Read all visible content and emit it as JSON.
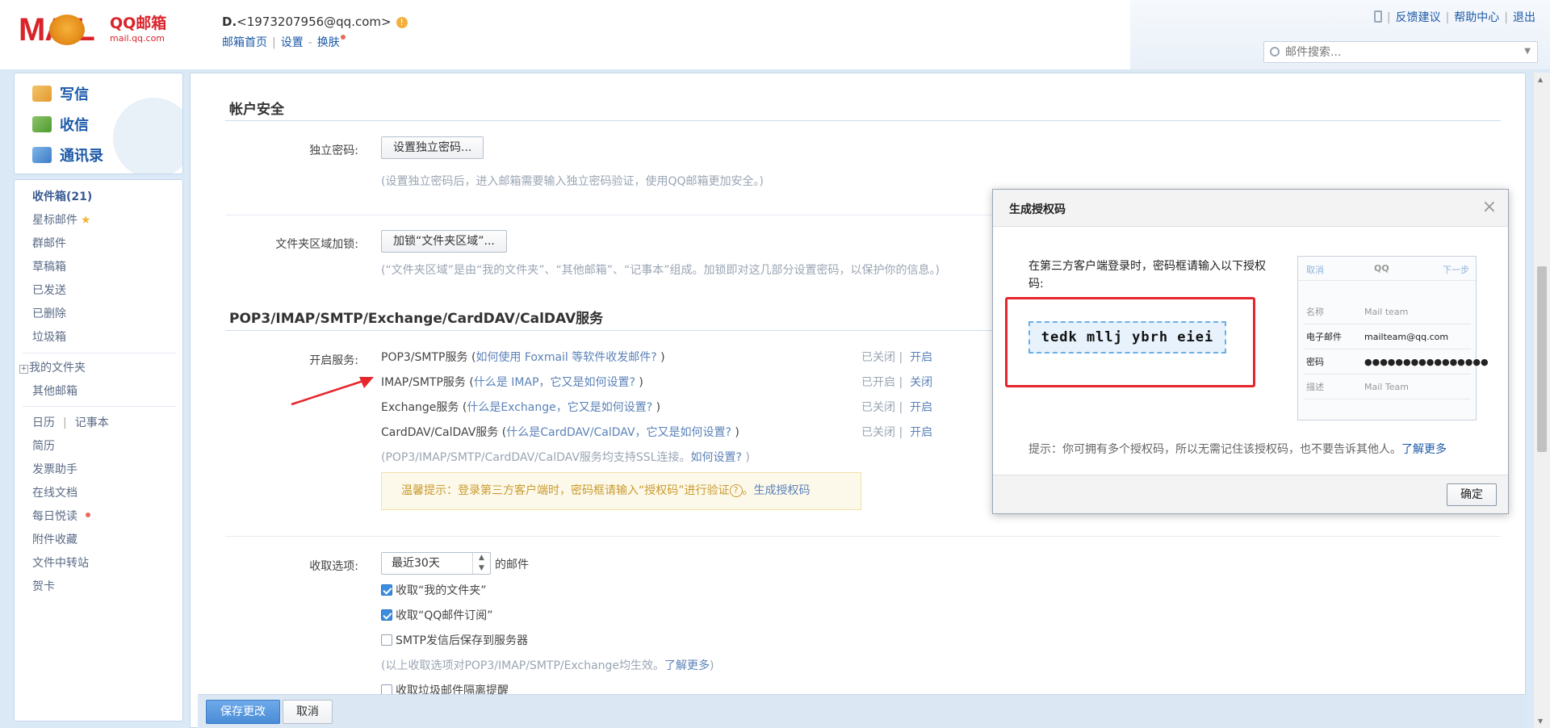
{
  "header": {
    "logo_text": "MAIL",
    "brand": "QQ邮箱",
    "brand_url": "mail.qq.com",
    "user_name": "D.",
    "user_email": "<1973207956@qq.com>",
    "links": [
      "邮箱首页",
      "设置",
      "换肤"
    ],
    "top_links": [
      "反馈建议",
      "帮助中心",
      "退出"
    ],
    "search_placeholder": "邮件搜索..."
  },
  "sidebar": {
    "actions": [
      "写信",
      "收信",
      "通讯录"
    ],
    "inbox": "收件箱(21)",
    "folders": [
      "星标邮件",
      "群邮件",
      "草稿箱",
      "已发送",
      "已删除",
      "垃圾箱"
    ],
    "my_folders": "我的文件夹",
    "other_mail": "其他邮箱",
    "calendar": "日历",
    "notebook": "记事本",
    "apps": [
      "简历",
      "发票助手",
      "在线文档",
      "每日悦读",
      "附件收藏",
      "文件中转站",
      "贺卡"
    ]
  },
  "account_security": {
    "title": "帐户安全",
    "independent_password": {
      "label": "独立密码:",
      "button": "设置独立密码...",
      "hint": "(设置独立密码后，进入邮箱需要输入独立密码验证，使用QQ邮箱更加安全。)"
    },
    "folder_lock": {
      "label": "文件夹区域加锁:",
      "button": "加锁“文件夹区域”...",
      "hint": "(“文件夹区域”是由“我的文件夹”、“其他邮箱”、“记事本”组成。加锁即对这几部分设置密码，以保护你的信息。)"
    }
  },
  "services": {
    "title": "POP3/IMAP/SMTP/Exchange/CardDAV/CalDAV服务",
    "label": "开启服务:",
    "rows": [
      {
        "name": "POP3/SMTP服务 (",
        "link": "如何使用 Foxmail 等软件收发邮件?",
        "close": " )",
        "state": "已关闭",
        "action": "开启"
      },
      {
        "name": "IMAP/SMTP服务 (",
        "link": "什么是 IMAP，它又是如何设置?",
        "close": " )",
        "state": "已开启",
        "action": "关闭"
      },
      {
        "name": "Exchange服务 (",
        "link": "什么是Exchange，它又是如何设置?",
        "close": " )",
        "state": "已关闭",
        "action": "开启"
      },
      {
        "name": "CardDAV/CalDAV服务 (",
        "link": "什么是CardDAV/CalDAV，它又是如何设置?",
        "close": " )",
        "state": "已关闭",
        "action": "开启"
      }
    ],
    "ssl_hint": "(POP3/IMAP/SMTP/CardDAV/CalDAV服务均支持SSL连接。",
    "ssl_link": "如何设置?",
    "ssl_close": " )",
    "tip": "温馨提示：登录第三方客户端时，密码框请输入“授权码”进行验证",
    "tip_q": "?",
    "tip_link": "生成授权码"
  },
  "receive": {
    "label": "收取选项:",
    "select_value": "最近30天",
    "suffix": "的邮件",
    "options": [
      {
        "label": "收取“我的文件夹”",
        "checked": true
      },
      {
        "label": "收取“QQ邮件订阅”",
        "checked": true
      },
      {
        "label": "SMTP发信后保存到服务器",
        "checked": false
      }
    ],
    "hint": "(以上收取选项对POP3/IMAP/SMTP/Exchange均生效。",
    "hint_link": "了解更多",
    "hint_close": ")",
    "partial_option": "收取垃圾邮件隔离提醒"
  },
  "footer": {
    "save": "保存更改",
    "cancel": "取消"
  },
  "modal": {
    "title": "生成授权码",
    "close": "×",
    "intro": "在第三方客户端登录时，密码框请输入以下授权码:",
    "code": "tedk mllj ybrh eiei",
    "note": "提示：你可拥有多个授权码，所以无需记住该授权码，也不要告诉其他人。",
    "note_link": "了解更多",
    "ok": "确定",
    "mock": {
      "cancel": "取消",
      "brand": "QQ",
      "next": "下一步",
      "rows": [
        {
          "k": "名称",
          "v": "Mail team"
        },
        {
          "k": "电子邮件",
          "v": "mailteam@qq.com"
        },
        {
          "k": "密码",
          "v": "●●●●●●●●●●●●●●●●"
        },
        {
          "k": "描述",
          "v": "Mail Team"
        }
      ]
    }
  },
  "colors": {
    "accent": "#1d5aa8",
    "brand_red": "#d9232a",
    "highlight_red": "#e5262c",
    "primary_button": "#4a8cd6"
  }
}
